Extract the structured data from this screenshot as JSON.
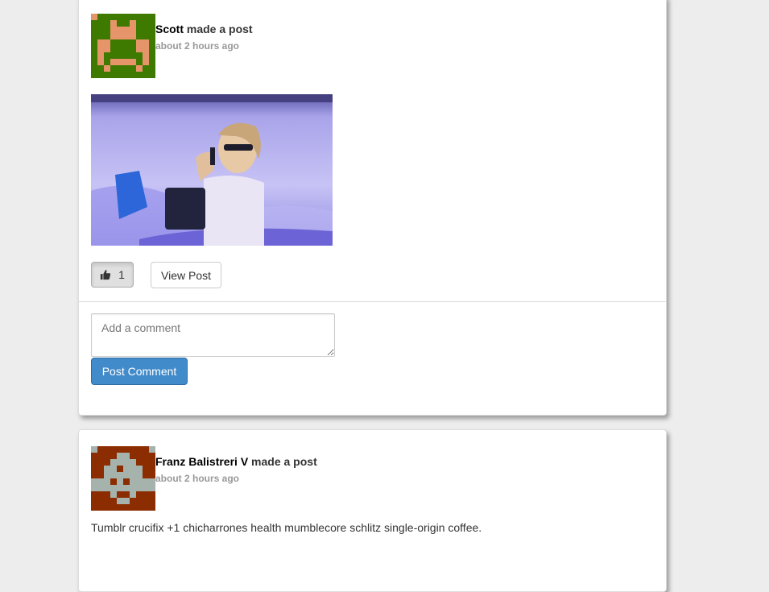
{
  "posts": [
    {
      "author": "Scott",
      "action": "made a post",
      "time": "about 2 hours ago",
      "avatar_icon": "pixel-invader-avatar",
      "avatar_colors": {
        "background": "#3f7a00",
        "foreground": "#e6946a"
      },
      "image_icon": "man-on-phone-photo",
      "like_count": "1",
      "view_label": "View Post",
      "comment_placeholder": "Add a comment",
      "comment_button": "Post Comment"
    },
    {
      "author": "Franz Balistreri V",
      "action": "made a post",
      "time": "about 2 hours ago",
      "avatar_icon": "pixel-invader-avatar",
      "avatar_colors": {
        "background": "#8b2d00",
        "foreground": "#a6b3ad"
      },
      "body": "Tumblr crucifix +1 chicharrones health mumblecore schlitz single-origin coffee."
    }
  ],
  "colors": {
    "page_background": "#ededed",
    "primary": "#428bca",
    "muted_text": "#999999"
  }
}
